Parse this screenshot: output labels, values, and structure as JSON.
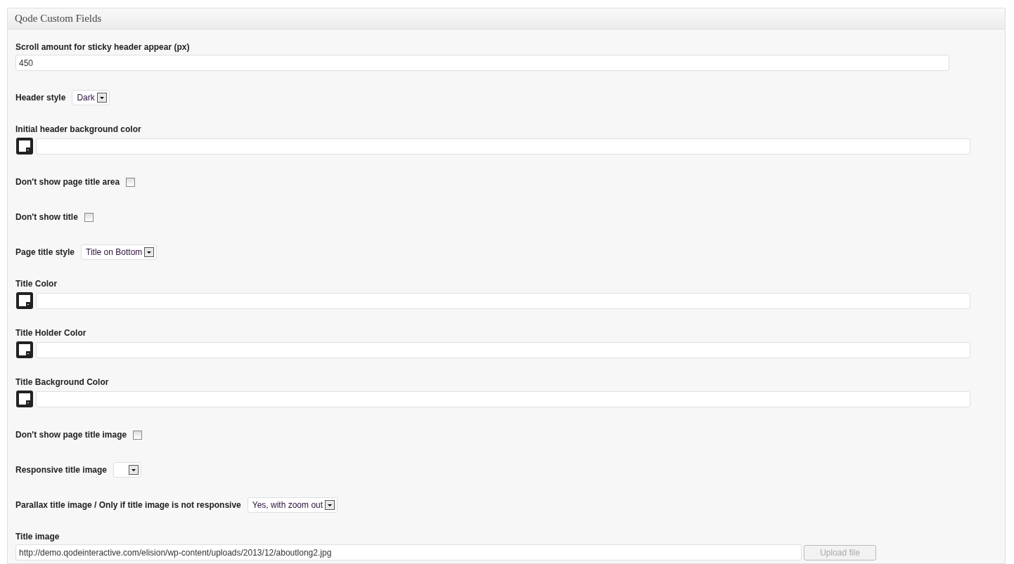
{
  "panel": {
    "title": "Qode Custom Fields"
  },
  "fields": [
    {
      "kind": "text",
      "label": "Scroll amount for sticky header appear (px)",
      "value": "450"
    },
    {
      "kind": "select",
      "label": "Header style",
      "value": "Dark"
    },
    {
      "kind": "color",
      "label": "Initial header background color"
    },
    {
      "kind": "checkbox",
      "label": "Don't show page title area",
      "checked": false
    },
    {
      "kind": "checkbox",
      "label": "Don't show title",
      "checked": false
    },
    {
      "kind": "select",
      "label": "Page title style",
      "value": "Title on Bottom"
    },
    {
      "kind": "color",
      "label": "Title Color"
    },
    {
      "kind": "color",
      "label": "Title Holder Color"
    },
    {
      "kind": "color",
      "label": "Title Background Color"
    },
    {
      "kind": "checkbox",
      "label": "Don't show page title image",
      "checked": false
    },
    {
      "kind": "select",
      "label": "Responsive title image"
    },
    {
      "kind": "select",
      "label": "Parallax title image / Only if title image is not responsive",
      "value": "Yes, with zoom out"
    },
    {
      "kind": "upload",
      "label": "Title image",
      "value": "http://demo.qodeinteractive.com/elision/wp-content/uploads/2013/12/aboutlong2.jpg",
      "button": "Upload file",
      "disabled": true
    }
  ]
}
